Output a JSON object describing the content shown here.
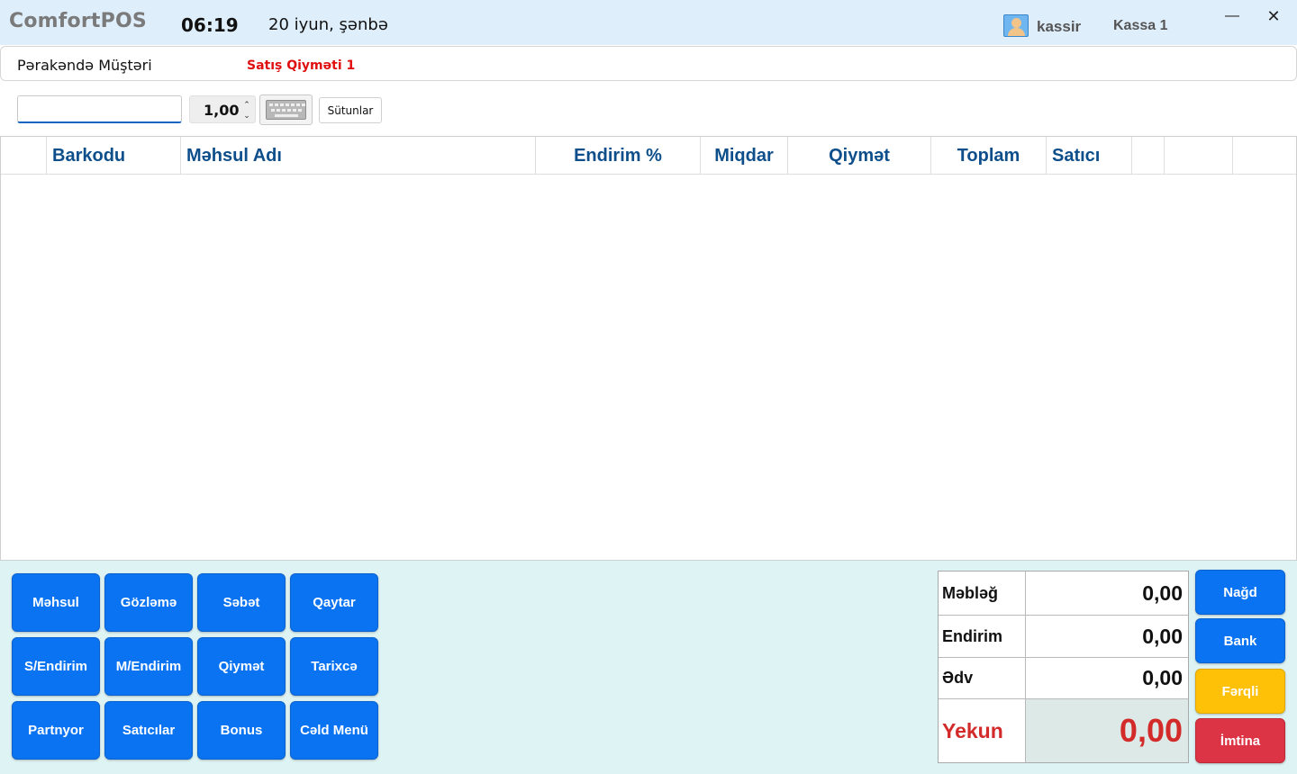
{
  "header": {
    "app_title": "ComfortPOS",
    "time": "06:19",
    "date": "20 iyun, şənbə",
    "user": "kassir",
    "register": "Kassa 1",
    "minimize_glyph": "—",
    "close_glyph": "✕"
  },
  "customer_bar": {
    "customer": "Pərakəndə Müştəri",
    "price_level": "Satış Qiyməti 1"
  },
  "input_row": {
    "barcode_value": "",
    "quantity": "1,00",
    "columns_button": "Sütunlar"
  },
  "grid": {
    "columns": [
      "",
      "Barkodu",
      "Məhsul Adı",
      "Endirim %",
      "Miqdar",
      "Qiymət",
      "Toplam",
      "Satıcı",
      "",
      "",
      ""
    ],
    "rows": []
  },
  "function_buttons": [
    [
      "Məhsul",
      "Gözləmə",
      "Səbət",
      "Qaytar"
    ],
    [
      "S/Endirim",
      "M/Endirim",
      "Qiymət",
      "Tarixcə"
    ],
    [
      "Partnyor",
      "Satıcılar",
      "Bonus",
      "Cəld Menü"
    ]
  ],
  "totals": {
    "amount_label": "Məbləğ",
    "amount": "0,00",
    "discount_label": "Endirim",
    "discount": "0,00",
    "vat_label": "Ədv",
    "vat": "0,00",
    "total_label": "Yekun",
    "total": "0,00"
  },
  "payment_buttons": {
    "cash": "Nağd",
    "bank": "Bank",
    "mixed": "Fərqli",
    "cancel": "İmtina"
  },
  "colors": {
    "title_bar": "#dfeefb",
    "bottom_panel": "#def3f4",
    "primary_button": "#0a73f2",
    "mixed_button": "#fec107",
    "cancel_button": "#dc3444",
    "total_red": "#d32a2a",
    "header_text": "#0e4f8b",
    "price_level_red": "#e01010"
  },
  "icons": {
    "user": "user-avatar-icon",
    "keyboard": "keyboard-icon",
    "spin_up": "chevron-up-icon",
    "spin_down": "chevron-down-icon"
  }
}
